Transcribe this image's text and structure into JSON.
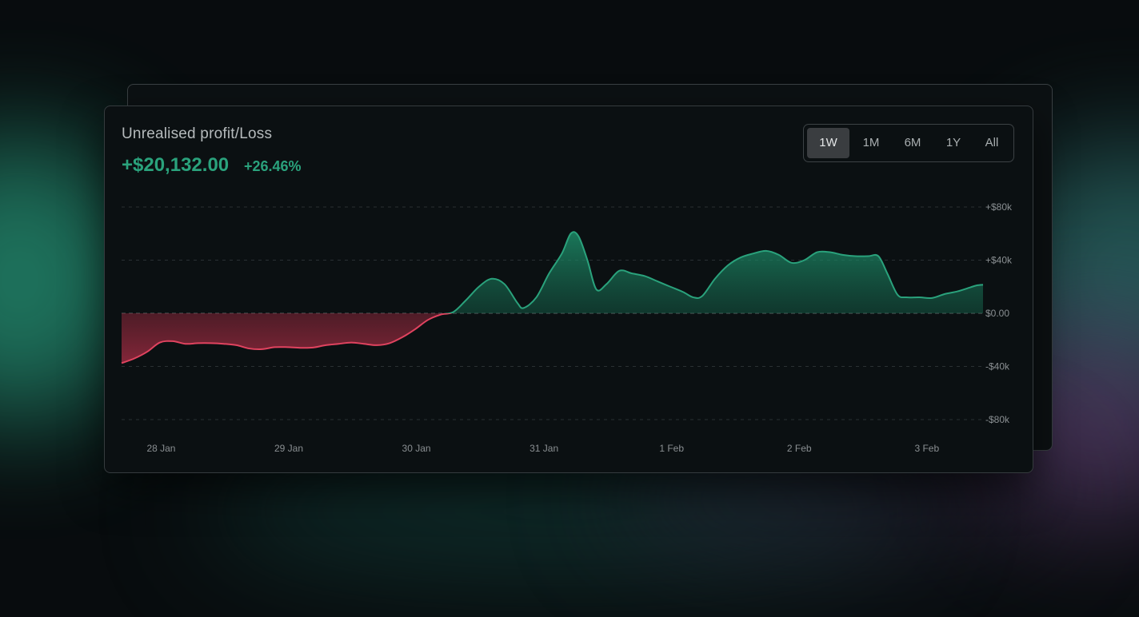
{
  "widget": {
    "title": "Unrealised profit/Loss",
    "amount": "+$20,132.00",
    "percent": "+26.46%",
    "accent_color": "#2aa27c",
    "loss_color": "#e0435f"
  },
  "ranges": [
    {
      "label": "1W",
      "active": true
    },
    {
      "label": "1M",
      "active": false
    },
    {
      "label": "6M",
      "active": false
    },
    {
      "label": "1Y",
      "active": false
    },
    {
      "label": "All",
      "active": false
    }
  ],
  "chart_data": {
    "type": "area",
    "y_tick_labels": [
      "+$80k",
      "+$40k",
      "$0.00",
      "-$40k",
      "-$80k"
    ],
    "y_ticks": [
      80000,
      40000,
      0,
      -40000,
      -80000
    ],
    "ylim": [
      -80000,
      80000
    ],
    "x_tick_labels": [
      "28 Jan",
      "29 Jan",
      "30 Jan",
      "31 Jan",
      "1 Feb",
      "2 Feb",
      "3 Feb"
    ],
    "x_ticks": [
      0.31,
      1.31,
      2.31,
      3.31,
      4.31,
      5.31,
      6.31
    ],
    "grid": true,
    "series": [
      {
        "values": [
          [
            0.0,
            -37500
          ],
          [
            0.1,
            -34000
          ],
          [
            0.2,
            -29000
          ],
          [
            0.3,
            -22000
          ],
          [
            0.4,
            -21000
          ],
          [
            0.5,
            -23000
          ],
          [
            0.6,
            -22500
          ],
          [
            0.7,
            -22500
          ],
          [
            0.8,
            -23000
          ],
          [
            0.9,
            -24000
          ],
          [
            1.0,
            -26500
          ],
          [
            1.1,
            -27000
          ],
          [
            1.2,
            -25500
          ],
          [
            1.3,
            -25500
          ],
          [
            1.4,
            -26000
          ],
          [
            1.5,
            -25800
          ],
          [
            1.6,
            -24000
          ],
          [
            1.7,
            -23000
          ],
          [
            1.8,
            -22000
          ],
          [
            1.9,
            -23000
          ],
          [
            2.0,
            -24000
          ],
          [
            2.1,
            -22500
          ],
          [
            2.2,
            -18000
          ],
          [
            2.3,
            -12000
          ],
          [
            2.4,
            -5000
          ],
          [
            2.5,
            -1000
          ],
          [
            2.6,
            1000
          ],
          [
            2.7,
            10000
          ],
          [
            2.8,
            20000
          ],
          [
            2.9,
            26000
          ],
          [
            3.0,
            22000
          ],
          [
            3.1,
            8000
          ],
          [
            3.15,
            4000
          ],
          [
            3.25,
            12000
          ],
          [
            3.35,
            30000
          ],
          [
            3.45,
            45000
          ],
          [
            3.52,
            60000
          ],
          [
            3.58,
            58000
          ],
          [
            3.65,
            40000
          ],
          [
            3.72,
            18000
          ],
          [
            3.8,
            22000
          ],
          [
            3.9,
            32000
          ],
          [
            4.0,
            30000
          ],
          [
            4.1,
            28000
          ],
          [
            4.2,
            24000
          ],
          [
            4.3,
            20000
          ],
          [
            4.4,
            16000
          ],
          [
            4.48,
            12000
          ],
          [
            4.55,
            13000
          ],
          [
            4.65,
            26000
          ],
          [
            4.75,
            36000
          ],
          [
            4.85,
            42000
          ],
          [
            4.95,
            45000
          ],
          [
            5.05,
            47000
          ],
          [
            5.15,
            44000
          ],
          [
            5.25,
            38000
          ],
          [
            5.35,
            40000
          ],
          [
            5.45,
            46000
          ],
          [
            5.55,
            46000
          ],
          [
            5.65,
            44000
          ],
          [
            5.75,
            43000
          ],
          [
            5.85,
            43000
          ],
          [
            5.93,
            43000
          ],
          [
            6.0,
            30000
          ],
          [
            6.08,
            14000
          ],
          [
            6.15,
            12000
          ],
          [
            6.25,
            12000
          ],
          [
            6.35,
            11500
          ],
          [
            6.45,
            14500
          ],
          [
            6.55,
            16500
          ],
          [
            6.65,
            19500
          ],
          [
            6.7,
            21000
          ],
          [
            6.75,
            21500
          ]
        ]
      }
    ]
  }
}
